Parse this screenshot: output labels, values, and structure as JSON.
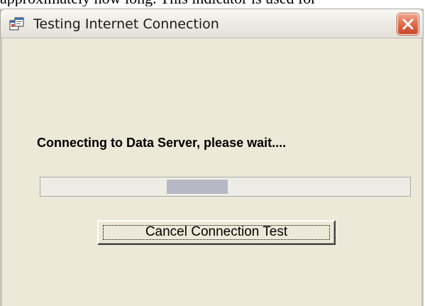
{
  "document": {
    "partial_text": "approximately how long. This indicator is used for"
  },
  "window": {
    "title": "Testing Internet Connection",
    "title_icon": "app-window-icon",
    "close_icon": "close-icon",
    "close_button_color": "#d9593a"
  },
  "dialog": {
    "message": "Connecting to Data Server, please wait....",
    "progress": {
      "type": "indeterminate-marquee",
      "block_start_fraction": 0.341,
      "block_end_fraction": 0.506,
      "block_color": "#b6b8c6",
      "track_color": "#eeede5"
    },
    "cancel_button_label": "Cancel Connection Test"
  }
}
